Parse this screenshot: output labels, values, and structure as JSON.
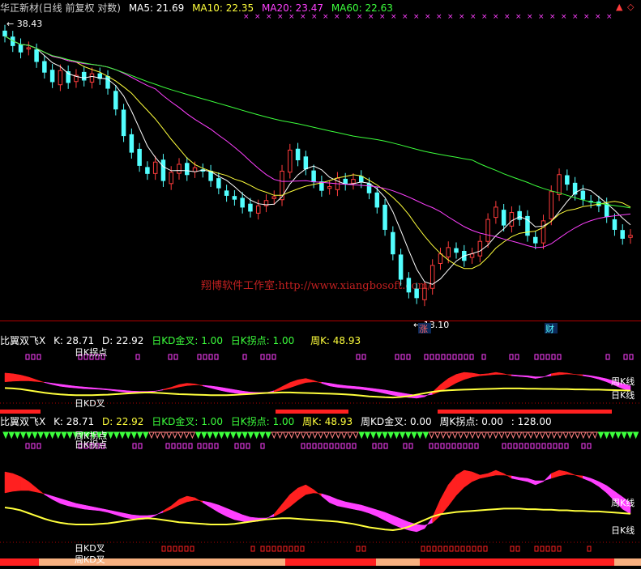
{
  "header": {
    "title": "华正新材(日线 前复权 对数)",
    "ma5": "MA5: 21.69",
    "ma10": "MA10: 22.35",
    "ma20": "MA20: 23.47",
    "ma60": "MA60: 22.63",
    "high_label": "38.43",
    "low_label": "13.10",
    "marker_zhang": "涨",
    "marker_cai": "财",
    "watermark": "翔博软件工作室:http://www.xiangbosoft.com/"
  },
  "panel2": {
    "name": "比翼双飞X",
    "k": "K: 28.71",
    "d": "D: 22.92",
    "kd_gold": "日KD金叉: 1.00",
    "k_turn": "日K拐点: 1.00",
    "week_k": "周K: 48.93",
    "label_rikgd": "日K拐点",
    "label_rikdc": "日KD叉",
    "label_zhouk": "周K线",
    "label_rik": "日K线"
  },
  "panel3": {
    "name": "比翼双飞X",
    "k": "K: 28.71",
    "d": "D: 22.92",
    "kd_gold": "日KD金叉: 1.00",
    "k_turn": "日K拐点: 1.00",
    "week_k": "周K: 48.93",
    "week_kd_gold": "周KD金叉: 0.00",
    "week_k_turn": "周K拐点: 0.00",
    "extra": ": 128.00",
    "label_zhoukgd": "周K拐点",
    "label_rikgd": "日K拐点",
    "label_rikdc": "日KD叉",
    "label_zhoukdc": "周KD叉",
    "label_zhouk": "周K线",
    "label_rik": "日K线"
  },
  "colors": {
    "up": "#ff3c3c",
    "down": "#53ffff",
    "ma5": "#ffffff",
    "ma10": "#ffff3c",
    "ma20": "#ff40ff",
    "ma60": "#3cff3c",
    "magenta": "#ff40ff",
    "red": "#ff2020",
    "yellow": "#ffff3c",
    "green": "#3cff3c",
    "salmon": "#f7b080",
    "axis": "#b00000"
  },
  "chart_data": {
    "type": "candlestick",
    "close": [
      37.2,
      35.8,
      34.9,
      35.5,
      33.6,
      32.2,
      31.0,
      32.4,
      30.9,
      31.8,
      31.2,
      32.0,
      31.4,
      30.2,
      27.8,
      25.0,
      23.4,
      22.2,
      21.5,
      22.5,
      20.9,
      21.6,
      22.3,
      21.4,
      22.0,
      21.7,
      20.9,
      20.3,
      19.7,
      19.4,
      18.8,
      18.5,
      18.9,
      19.3,
      19.6,
      21.7,
      23.6,
      22.7,
      21.9,
      20.8,
      20.1,
      20.4,
      21.1,
      20.6,
      21.0,
      20.8,
      19.9,
      18.8,
      17.2,
      15.6,
      14.1,
      13.4,
      13.1,
      13.6,
      14.9,
      15.6,
      16.0,
      15.7,
      15.2,
      15.6,
      16.4,
      17.9,
      18.8,
      17.5,
      18.4,
      17.9,
      16.8,
      16.3,
      17.8,
      20.0,
      21.4,
      20.6,
      19.8,
      19.4,
      19.2,
      18.9,
      18.1,
      17.2,
      16.6,
      16.8
    ],
    "ma5_last": 21.69,
    "ma10_last": 22.35,
    "ma20_last": 23.47,
    "ma60_last": 22.63,
    "price_high": 38.43,
    "price_low": 13.1,
    "k_daily": [
      86,
      84,
      80,
      74,
      66,
      58,
      52,
      47,
      44,
      42,
      40,
      39,
      38,
      36,
      33,
      30,
      28,
      27,
      28,
      32,
      38,
      44,
      52,
      56,
      54,
      48,
      42,
      36,
      31,
      27,
      25,
      24,
      25,
      28,
      34,
      46,
      58,
      66,
      70,
      64,
      56,
      48,
      44,
      42,
      40,
      38,
      35,
      31,
      26,
      21,
      17,
      14,
      12,
      16,
      30,
      52,
      70,
      82,
      88,
      86,
      82,
      84,
      88,
      84,
      78,
      76,
      74,
      70,
      74,
      84,
      88,
      86,
      82,
      78,
      74,
      68,
      60,
      50,
      40,
      34
    ],
    "d_daily": [
      60,
      62,
      63,
      63,
      61,
      59,
      56,
      53,
      50,
      47,
      45,
      43,
      41,
      39,
      37,
      35,
      33,
      32,
      32,
      33,
      36,
      40,
      45,
      49,
      51,
      50,
      48,
      45,
      41,
      37,
      33,
      30,
      29,
      29,
      31,
      36,
      43,
      51,
      58,
      60,
      59,
      56,
      52,
      49,
      47,
      45,
      42,
      39,
      36,
      32,
      28,
      24,
      21,
      20,
      23,
      32,
      44,
      57,
      67,
      74,
      78,
      80,
      82,
      82,
      81,
      79,
      78,
      75,
      75,
      78,
      81,
      83,
      82,
      81,
      78,
      74,
      69,
      62,
      55,
      48
    ],
    "k_weekly": [
      60,
      58,
      55,
      50,
      45,
      40,
      36,
      33,
      31,
      30,
      30,
      30,
      31,
      32,
      34,
      36,
      38,
      40,
      41,
      40,
      38,
      36,
      34,
      33,
      32,
      31,
      30,
      30,
      30,
      31,
      33,
      35,
      37,
      39,
      40,
      41,
      41,
      40,
      39,
      38,
      37,
      36,
      35,
      33,
      31,
      28,
      25,
      23,
      21,
      20,
      22,
      26,
      32,
      38,
      44,
      48,
      50,
      52,
      53,
      54,
      55,
      56,
      57,
      58,
      58,
      58,
      57,
      57,
      56,
      56,
      55,
      55,
      54,
      54,
      53,
      53,
      52,
      51,
      50,
      49
    ]
  }
}
